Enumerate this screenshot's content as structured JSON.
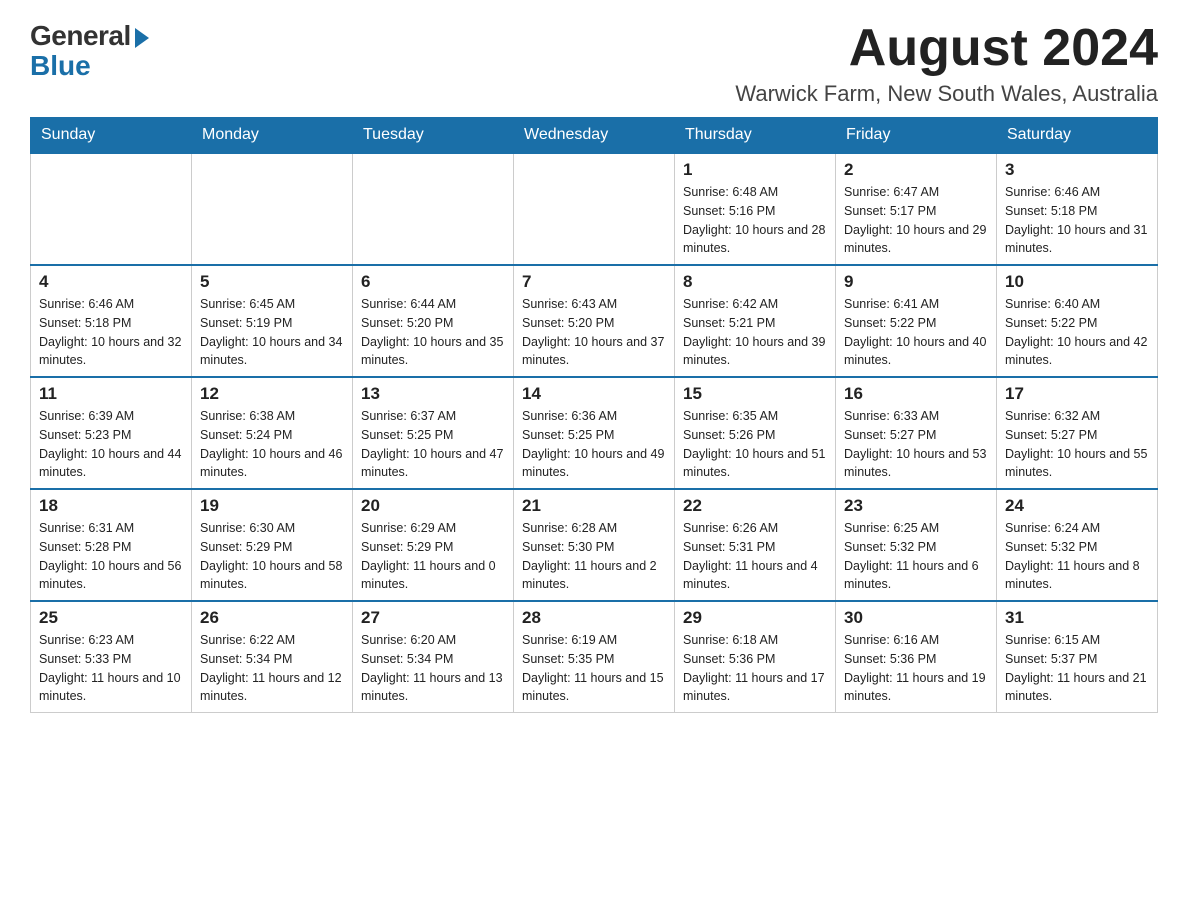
{
  "header": {
    "logo_general": "General",
    "logo_blue": "Blue",
    "month_year": "August 2024",
    "location": "Warwick Farm, New South Wales, Australia"
  },
  "days_of_week": [
    "Sunday",
    "Monday",
    "Tuesday",
    "Wednesday",
    "Thursday",
    "Friday",
    "Saturday"
  ],
  "weeks": [
    [
      {
        "day": "",
        "sunrise": "",
        "sunset": "",
        "daylight": ""
      },
      {
        "day": "",
        "sunrise": "",
        "sunset": "",
        "daylight": ""
      },
      {
        "day": "",
        "sunrise": "",
        "sunset": "",
        "daylight": ""
      },
      {
        "day": "",
        "sunrise": "",
        "sunset": "",
        "daylight": ""
      },
      {
        "day": "1",
        "sunrise": "Sunrise: 6:48 AM",
        "sunset": "Sunset: 5:16 PM",
        "daylight": "Daylight: 10 hours and 28 minutes."
      },
      {
        "day": "2",
        "sunrise": "Sunrise: 6:47 AM",
        "sunset": "Sunset: 5:17 PM",
        "daylight": "Daylight: 10 hours and 29 minutes."
      },
      {
        "day": "3",
        "sunrise": "Sunrise: 6:46 AM",
        "sunset": "Sunset: 5:18 PM",
        "daylight": "Daylight: 10 hours and 31 minutes."
      }
    ],
    [
      {
        "day": "4",
        "sunrise": "Sunrise: 6:46 AM",
        "sunset": "Sunset: 5:18 PM",
        "daylight": "Daylight: 10 hours and 32 minutes."
      },
      {
        "day": "5",
        "sunrise": "Sunrise: 6:45 AM",
        "sunset": "Sunset: 5:19 PM",
        "daylight": "Daylight: 10 hours and 34 minutes."
      },
      {
        "day": "6",
        "sunrise": "Sunrise: 6:44 AM",
        "sunset": "Sunset: 5:20 PM",
        "daylight": "Daylight: 10 hours and 35 minutes."
      },
      {
        "day": "7",
        "sunrise": "Sunrise: 6:43 AM",
        "sunset": "Sunset: 5:20 PM",
        "daylight": "Daylight: 10 hours and 37 minutes."
      },
      {
        "day": "8",
        "sunrise": "Sunrise: 6:42 AM",
        "sunset": "Sunset: 5:21 PM",
        "daylight": "Daylight: 10 hours and 39 minutes."
      },
      {
        "day": "9",
        "sunrise": "Sunrise: 6:41 AM",
        "sunset": "Sunset: 5:22 PM",
        "daylight": "Daylight: 10 hours and 40 minutes."
      },
      {
        "day": "10",
        "sunrise": "Sunrise: 6:40 AM",
        "sunset": "Sunset: 5:22 PM",
        "daylight": "Daylight: 10 hours and 42 minutes."
      }
    ],
    [
      {
        "day": "11",
        "sunrise": "Sunrise: 6:39 AM",
        "sunset": "Sunset: 5:23 PM",
        "daylight": "Daylight: 10 hours and 44 minutes."
      },
      {
        "day": "12",
        "sunrise": "Sunrise: 6:38 AM",
        "sunset": "Sunset: 5:24 PM",
        "daylight": "Daylight: 10 hours and 46 minutes."
      },
      {
        "day": "13",
        "sunrise": "Sunrise: 6:37 AM",
        "sunset": "Sunset: 5:25 PM",
        "daylight": "Daylight: 10 hours and 47 minutes."
      },
      {
        "day": "14",
        "sunrise": "Sunrise: 6:36 AM",
        "sunset": "Sunset: 5:25 PM",
        "daylight": "Daylight: 10 hours and 49 minutes."
      },
      {
        "day": "15",
        "sunrise": "Sunrise: 6:35 AM",
        "sunset": "Sunset: 5:26 PM",
        "daylight": "Daylight: 10 hours and 51 minutes."
      },
      {
        "day": "16",
        "sunrise": "Sunrise: 6:33 AM",
        "sunset": "Sunset: 5:27 PM",
        "daylight": "Daylight: 10 hours and 53 minutes."
      },
      {
        "day": "17",
        "sunrise": "Sunrise: 6:32 AM",
        "sunset": "Sunset: 5:27 PM",
        "daylight": "Daylight: 10 hours and 55 minutes."
      }
    ],
    [
      {
        "day": "18",
        "sunrise": "Sunrise: 6:31 AM",
        "sunset": "Sunset: 5:28 PM",
        "daylight": "Daylight: 10 hours and 56 minutes."
      },
      {
        "day": "19",
        "sunrise": "Sunrise: 6:30 AM",
        "sunset": "Sunset: 5:29 PM",
        "daylight": "Daylight: 10 hours and 58 minutes."
      },
      {
        "day": "20",
        "sunrise": "Sunrise: 6:29 AM",
        "sunset": "Sunset: 5:29 PM",
        "daylight": "Daylight: 11 hours and 0 minutes."
      },
      {
        "day": "21",
        "sunrise": "Sunrise: 6:28 AM",
        "sunset": "Sunset: 5:30 PM",
        "daylight": "Daylight: 11 hours and 2 minutes."
      },
      {
        "day": "22",
        "sunrise": "Sunrise: 6:26 AM",
        "sunset": "Sunset: 5:31 PM",
        "daylight": "Daylight: 11 hours and 4 minutes."
      },
      {
        "day": "23",
        "sunrise": "Sunrise: 6:25 AM",
        "sunset": "Sunset: 5:32 PM",
        "daylight": "Daylight: 11 hours and 6 minutes."
      },
      {
        "day": "24",
        "sunrise": "Sunrise: 6:24 AM",
        "sunset": "Sunset: 5:32 PM",
        "daylight": "Daylight: 11 hours and 8 minutes."
      }
    ],
    [
      {
        "day": "25",
        "sunrise": "Sunrise: 6:23 AM",
        "sunset": "Sunset: 5:33 PM",
        "daylight": "Daylight: 11 hours and 10 minutes."
      },
      {
        "day": "26",
        "sunrise": "Sunrise: 6:22 AM",
        "sunset": "Sunset: 5:34 PM",
        "daylight": "Daylight: 11 hours and 12 minutes."
      },
      {
        "day": "27",
        "sunrise": "Sunrise: 6:20 AM",
        "sunset": "Sunset: 5:34 PM",
        "daylight": "Daylight: 11 hours and 13 minutes."
      },
      {
        "day": "28",
        "sunrise": "Sunrise: 6:19 AM",
        "sunset": "Sunset: 5:35 PM",
        "daylight": "Daylight: 11 hours and 15 minutes."
      },
      {
        "day": "29",
        "sunrise": "Sunrise: 6:18 AM",
        "sunset": "Sunset: 5:36 PM",
        "daylight": "Daylight: 11 hours and 17 minutes."
      },
      {
        "day": "30",
        "sunrise": "Sunrise: 6:16 AM",
        "sunset": "Sunset: 5:36 PM",
        "daylight": "Daylight: 11 hours and 19 minutes."
      },
      {
        "day": "31",
        "sunrise": "Sunrise: 6:15 AM",
        "sunset": "Sunset: 5:37 PM",
        "daylight": "Daylight: 11 hours and 21 minutes."
      }
    ]
  ]
}
